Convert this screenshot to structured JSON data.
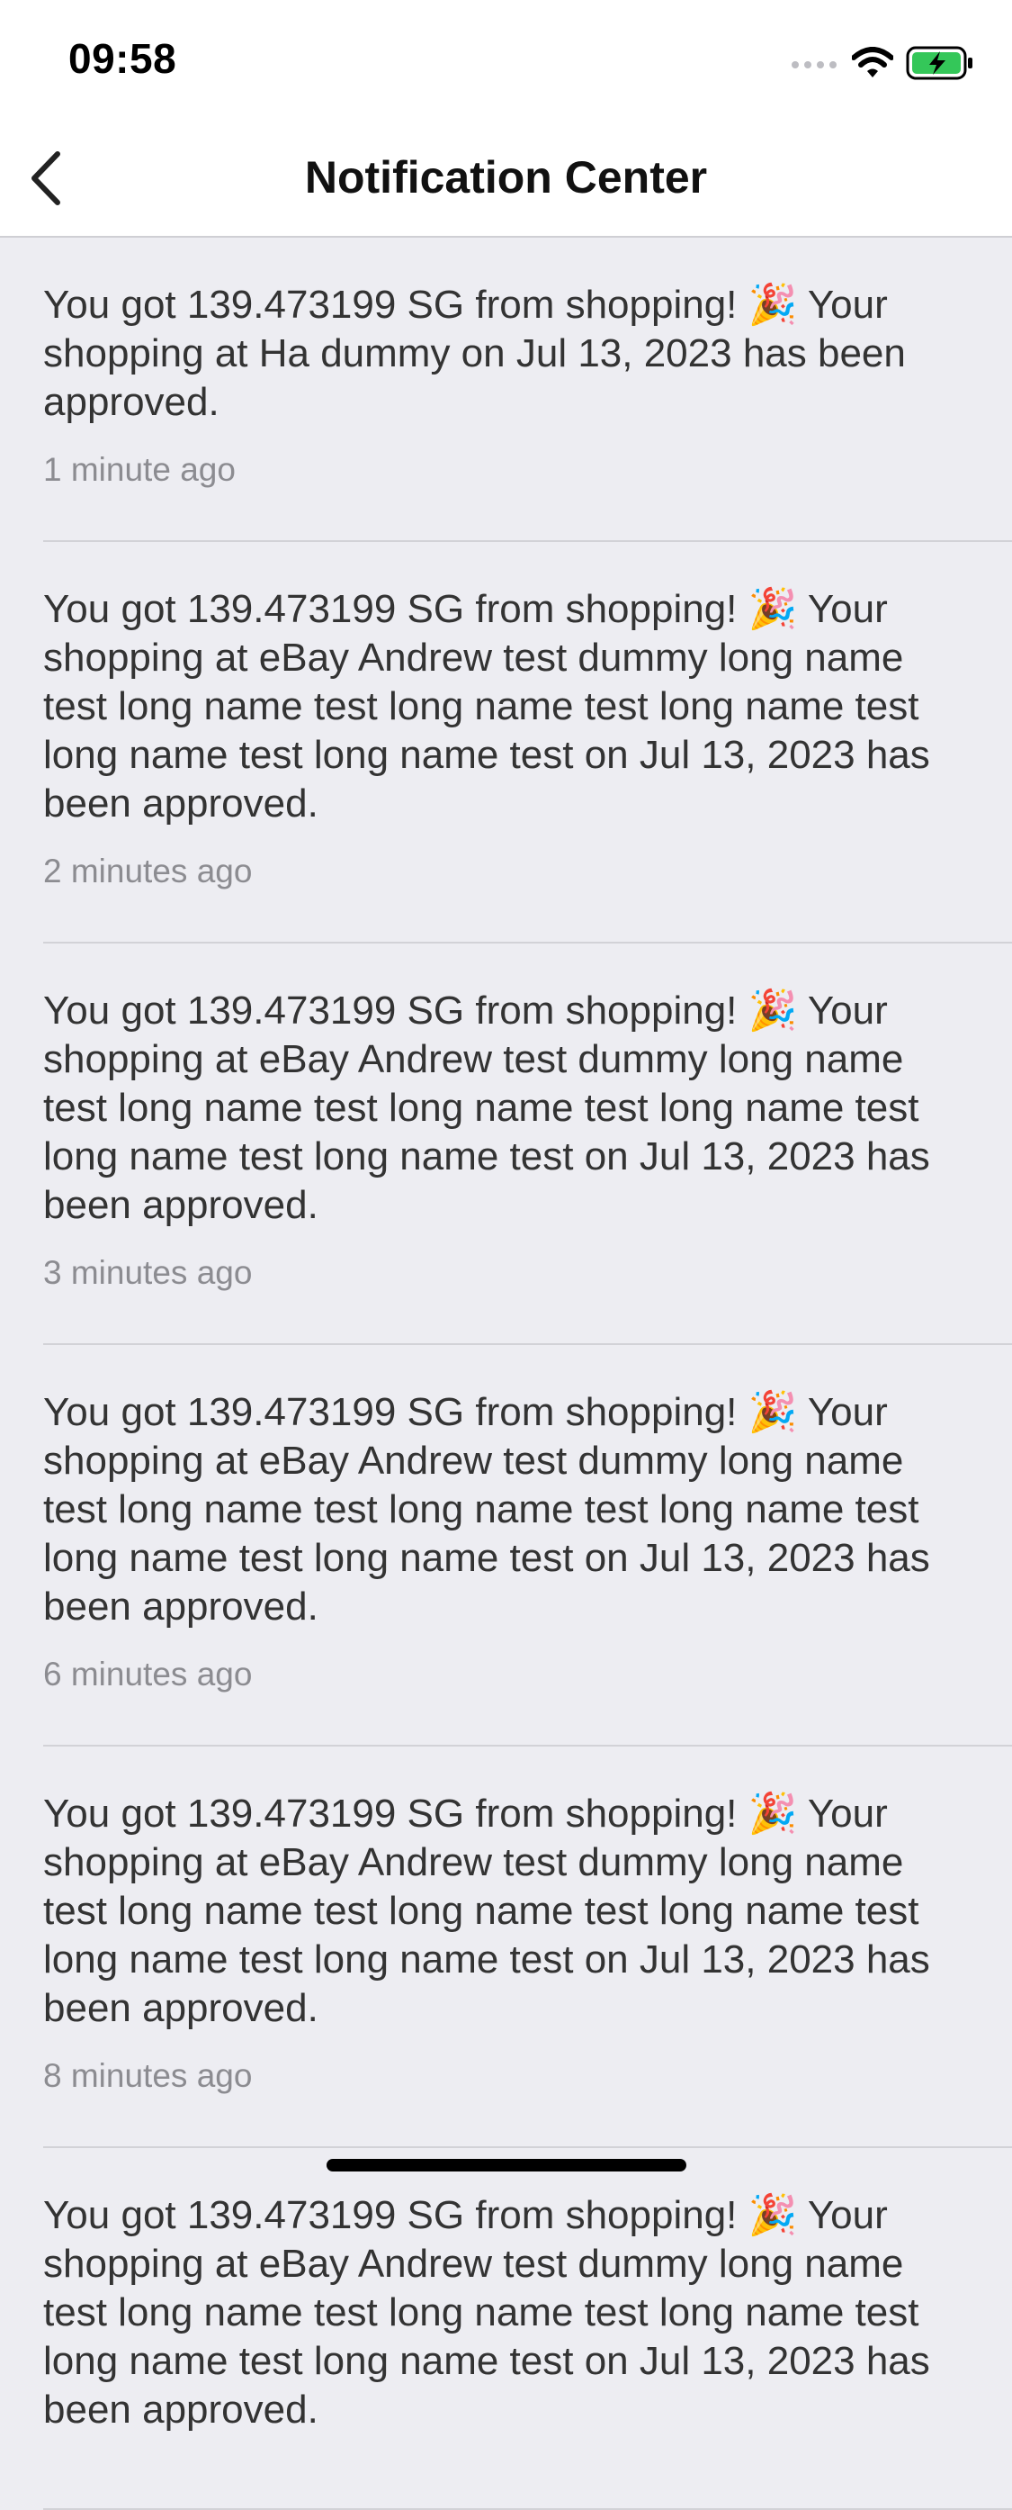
{
  "status_bar": {
    "time": "09:58",
    "battery_color": "#34c759"
  },
  "nav": {
    "title": "Notification Center",
    "back_icon": "chevron-left-icon"
  },
  "notifications": [
    {
      "message": "You got 139.473199 SG from shopping! 🎉 Your shopping at Ha dummy on Jul 13, 2023 has been approved.",
      "time": "1 minute ago"
    },
    {
      "message": "You got 139.473199 SG from shopping! 🎉 Your shopping at eBay Andrew test dummy long name test long name test long name test long name test long name test long name test on Jul 13, 2023 has been approved.",
      "time": "2 minutes ago"
    },
    {
      "message": "You got 139.473199 SG from shopping! 🎉 Your shopping at eBay Andrew test dummy long name test long name test long name test long name test long name test long name test on Jul 13, 2023 has been approved.",
      "time": "3 minutes ago"
    },
    {
      "message": "You got 139.473199 SG from shopping! 🎉 Your shopping at eBay Andrew test dummy long name test long name test long name test long name test long name test long name test on Jul 13, 2023 has been approved.",
      "time": "6 minutes ago"
    },
    {
      "message": "You got 139.473199 SG from shopping! 🎉 Your shopping at eBay Andrew test dummy long name test long name test long name test long name test long name test long name test on Jul 13, 2023 has been approved.",
      "time": "8 minutes ago"
    },
    {
      "message": "You got 139.473199 SG from shopping! 🎉 Your shopping at eBay Andrew test dummy long name test long name test long name test long name test long name test long name test on Jul 13, 2023 has been approved.",
      "time": ""
    }
  ]
}
